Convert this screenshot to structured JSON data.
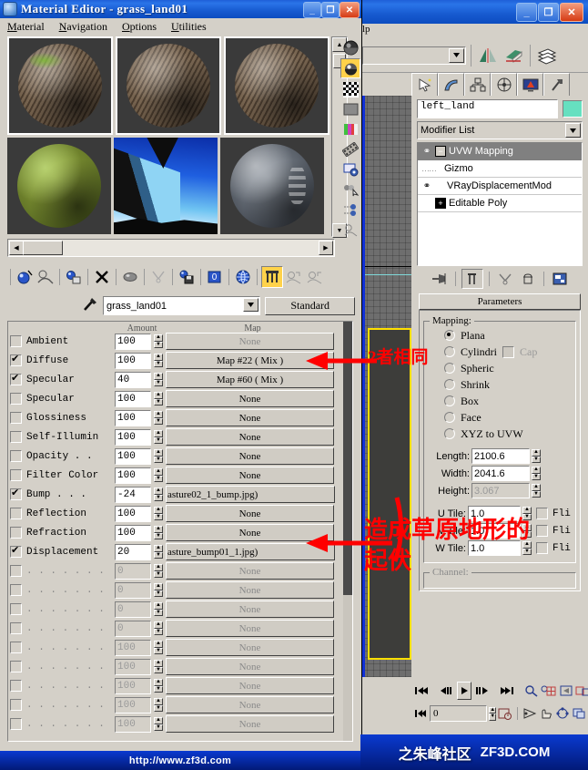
{
  "material_editor": {
    "title": "Material Editor - grass_land01",
    "icon": "material-editor-icon",
    "window_buttons": {
      "minimize": "_",
      "maximize": "❐",
      "close": "✕"
    },
    "menu": [
      {
        "label": "Material",
        "mnemonic": "M"
      },
      {
        "label": "Navigation",
        "mnemonic": "N"
      },
      {
        "label": "Options",
        "mnemonic": "O"
      },
      {
        "label": "Utilities",
        "mnemonic": "U"
      }
    ],
    "slots": [
      {
        "name": "slot-1",
        "type": "rock-grass",
        "active": true
      },
      {
        "name": "slot-2",
        "type": "rock",
        "active": true
      },
      {
        "name": "slot-3",
        "type": "rock",
        "active": true
      },
      {
        "name": "slot-4",
        "type": "green",
        "active": false
      },
      {
        "name": "slot-5",
        "type": "sky-environment",
        "active": false
      },
      {
        "name": "slot-6",
        "type": "gray-striped",
        "active": false
      }
    ],
    "side_tools": [
      "sample-type-sphere-icon",
      "backlight-icon",
      "background-checker-icon",
      "sample-uv-tiling-icon",
      "video-color-check-icon",
      "make-preview-icon",
      "options-icon",
      "select-by-material-icon",
      "material-id-channel-icon",
      "show-end-result-icon"
    ],
    "button_row": [
      "get-material-icon",
      "put-material-to-scene-icon",
      "assign-material-to-selection-icon",
      "reset-map-icon",
      "make-material-copy-icon",
      "make-unique-icon",
      "put-to-library-icon",
      "material-effects-channel-icon",
      "show-map-in-viewport-icon",
      "show-end-result-icon",
      "go-to-parent-icon",
      "go-forward-to-sibling-icon"
    ],
    "material_name": "grass_land01",
    "material_type_button": "Standard",
    "eyedropper_icon": "eyedropper-icon",
    "maps_rollout": {
      "header_amount": "Amount",
      "header_map": "Map",
      "lock_icon": "lock-icon",
      "rows": [
        {
          "label": "Ambient",
          "checked": false,
          "amount": "100",
          "amount_dim": false,
          "map": "None",
          "map_dim": true
        },
        {
          "label": "Diffuse",
          "checked": true,
          "amount": "100",
          "amount_dim": false,
          "map": "Map #22     ( Mix )",
          "map_dim": false
        },
        {
          "label": "Specular",
          "checked": true,
          "amount": "40",
          "amount_dim": false,
          "map": "Map #60     ( Mix )",
          "map_dim": false
        },
        {
          "label": "Specular",
          "checked": false,
          "amount": "100",
          "amount_dim": false,
          "map": "None",
          "map_dim": false
        },
        {
          "label": "Glossiness",
          "checked": false,
          "amount": "100",
          "amount_dim": false,
          "map": "None",
          "map_dim": false
        },
        {
          "label": "Self-Illumin",
          "checked": false,
          "amount": "100",
          "amount_dim": false,
          "map": "None",
          "map_dim": false
        },
        {
          "label": "Opacity . .",
          "checked": false,
          "amount": "100",
          "amount_dim": false,
          "map": "None",
          "map_dim": false
        },
        {
          "label": "Filter Color",
          "checked": false,
          "amount": "100",
          "amount_dim": false,
          "map": "None",
          "map_dim": false
        },
        {
          "label": "Bump . . .",
          "checked": true,
          "amount": "-24",
          "amount_dim": false,
          "map": "asture02_1_bump.jpg)",
          "map_file": true
        },
        {
          "label": "Reflection",
          "checked": false,
          "amount": "100",
          "amount_dim": false,
          "map": "None",
          "map_dim": false
        },
        {
          "label": "Refraction",
          "checked": false,
          "amount": "100",
          "amount_dim": false,
          "map": "None",
          "map_dim": false
        },
        {
          "label": "Displacement",
          "checked": true,
          "amount": "20",
          "amount_dim": false,
          "map": "asture_bump01_1.jpg)",
          "map_file": true
        },
        {
          "label": ". . . . . . .",
          "checked": false,
          "amount": "0",
          "amount_dim": true,
          "map": "None",
          "map_dim": true
        },
        {
          "label": ". . . . . . .",
          "checked": false,
          "amount": "0",
          "amount_dim": true,
          "map": "None",
          "map_dim": true
        },
        {
          "label": ". . . . . . .",
          "checked": false,
          "amount": "0",
          "amount_dim": true,
          "map": "None",
          "map_dim": true
        },
        {
          "label": ". . . . . . .",
          "checked": false,
          "amount": "0",
          "amount_dim": true,
          "map": "None",
          "map_dim": true
        },
        {
          "label": ". . . . . . .",
          "checked": false,
          "amount": "100",
          "amount_dim": true,
          "map": "None",
          "map_dim": true
        },
        {
          "label": ". . . . . . .",
          "checked": false,
          "amount": "100",
          "amount_dim": true,
          "map": "None",
          "map_dim": true
        },
        {
          "label": ". . . . . . .",
          "checked": false,
          "amount": "100",
          "amount_dim": true,
          "map": "None",
          "map_dim": true
        },
        {
          "label": ". . . . . . .",
          "checked": false,
          "amount": "100",
          "amount_dim": true,
          "map": "None",
          "map_dim": true
        },
        {
          "label": ". . . . . . .",
          "checked": false,
          "amount": "100",
          "amount_dim": true,
          "map": "None",
          "map_dim": true
        }
      ]
    }
  },
  "max_window": {
    "window_buttons": {
      "minimize": "_",
      "maximize": "❐",
      "close": "✕"
    },
    "menu_fragment": "lp",
    "toolbar": {
      "named_selection_value": "",
      "icons": [
        "mirror-icon",
        "align-icon",
        "layer-manager-icon"
      ]
    },
    "command_tabs": [
      "create-tab-icon",
      "modify-tab-icon",
      "hierarchy-tab-icon",
      "motion-tab-icon",
      "display-tab-icon",
      "utilities-tab-icon"
    ],
    "object_name": "left_land",
    "object_color": "#66e0c0",
    "modifier_list_label": "Modifier List",
    "modifier_stack": [
      {
        "label": "UVW Mapping",
        "selected": true,
        "has_bulb": true,
        "expander": "-"
      },
      {
        "label": "Gizmo",
        "selected": false,
        "sub": true
      },
      {
        "label": "VRayDisplacementMod",
        "selected": false,
        "has_bulb": true
      },
      {
        "label": "Editable Poly",
        "selected": false,
        "expander": "+"
      }
    ],
    "stack_tools": [
      "pin-stack-icon",
      "show-end-result-icon",
      "make-unique-icon",
      "remove-modifier-icon",
      "configure-modifier-sets-icon"
    ],
    "rollout": {
      "title": "Parameters",
      "group_title": "Mapping:",
      "mapping_options": [
        {
          "label": "Plana",
          "selected": true
        },
        {
          "label": "Cylindri",
          "selected": false,
          "extra_checkbox": "Cap"
        },
        {
          "label": "Spheric",
          "selected": false
        },
        {
          "label": "Shrink",
          "selected": false
        },
        {
          "label": "Box",
          "selected": false
        },
        {
          "label": "Face",
          "selected": false
        },
        {
          "label": "XYZ to UVW",
          "selected": false
        }
      ],
      "fields": [
        {
          "label": "Length:",
          "value": "2100.6",
          "dim": false
        },
        {
          "label": "Width:",
          "value": "2041.6",
          "dim": false
        },
        {
          "label": "Height:",
          "value": "3.067",
          "dim": true
        }
      ],
      "tiles": [
        {
          "label": "U Tile:",
          "value": "1.0",
          "flip_label": "Fli",
          "flip_checked": false
        },
        {
          "label": "V Tile:",
          "value": "1.0",
          "flip_label": "Fli",
          "flip_checked": false
        },
        {
          "label": "W Tile:",
          "value": "1.0",
          "flip_label": "Fli",
          "flip_checked": false
        }
      ],
      "next_group": "Channel:"
    },
    "animation_bar": {
      "transport_icons": [
        "go-to-start-icon",
        "previous-frame-icon",
        "play-animation-icon",
        "next-frame-icon",
        "go-to-end-icon"
      ],
      "view_icons": [
        "zoom-icon",
        "zoom-all-icon",
        "zoom-extents-icon",
        "zoom-region-icon"
      ],
      "frame_value": "0",
      "key_mode_icon": "key-mode-toggle-icon",
      "nav_icons": [
        "field-of-view-icon",
        "pan-view-icon",
        "arc-rotate-icon",
        "maximize-viewport-icon"
      ]
    }
  },
  "annotations": [
    {
      "name": "annotation-same-two",
      "text": "2者相同"
    },
    {
      "name": "annotation-terrain",
      "line1": "造成草原地形的",
      "line2": "起伏"
    }
  ],
  "footer": {
    "left_url": "http://www.zf3d.com",
    "right_brand": "之朱峰社区",
    "right_url": "ZF3D.COM"
  }
}
